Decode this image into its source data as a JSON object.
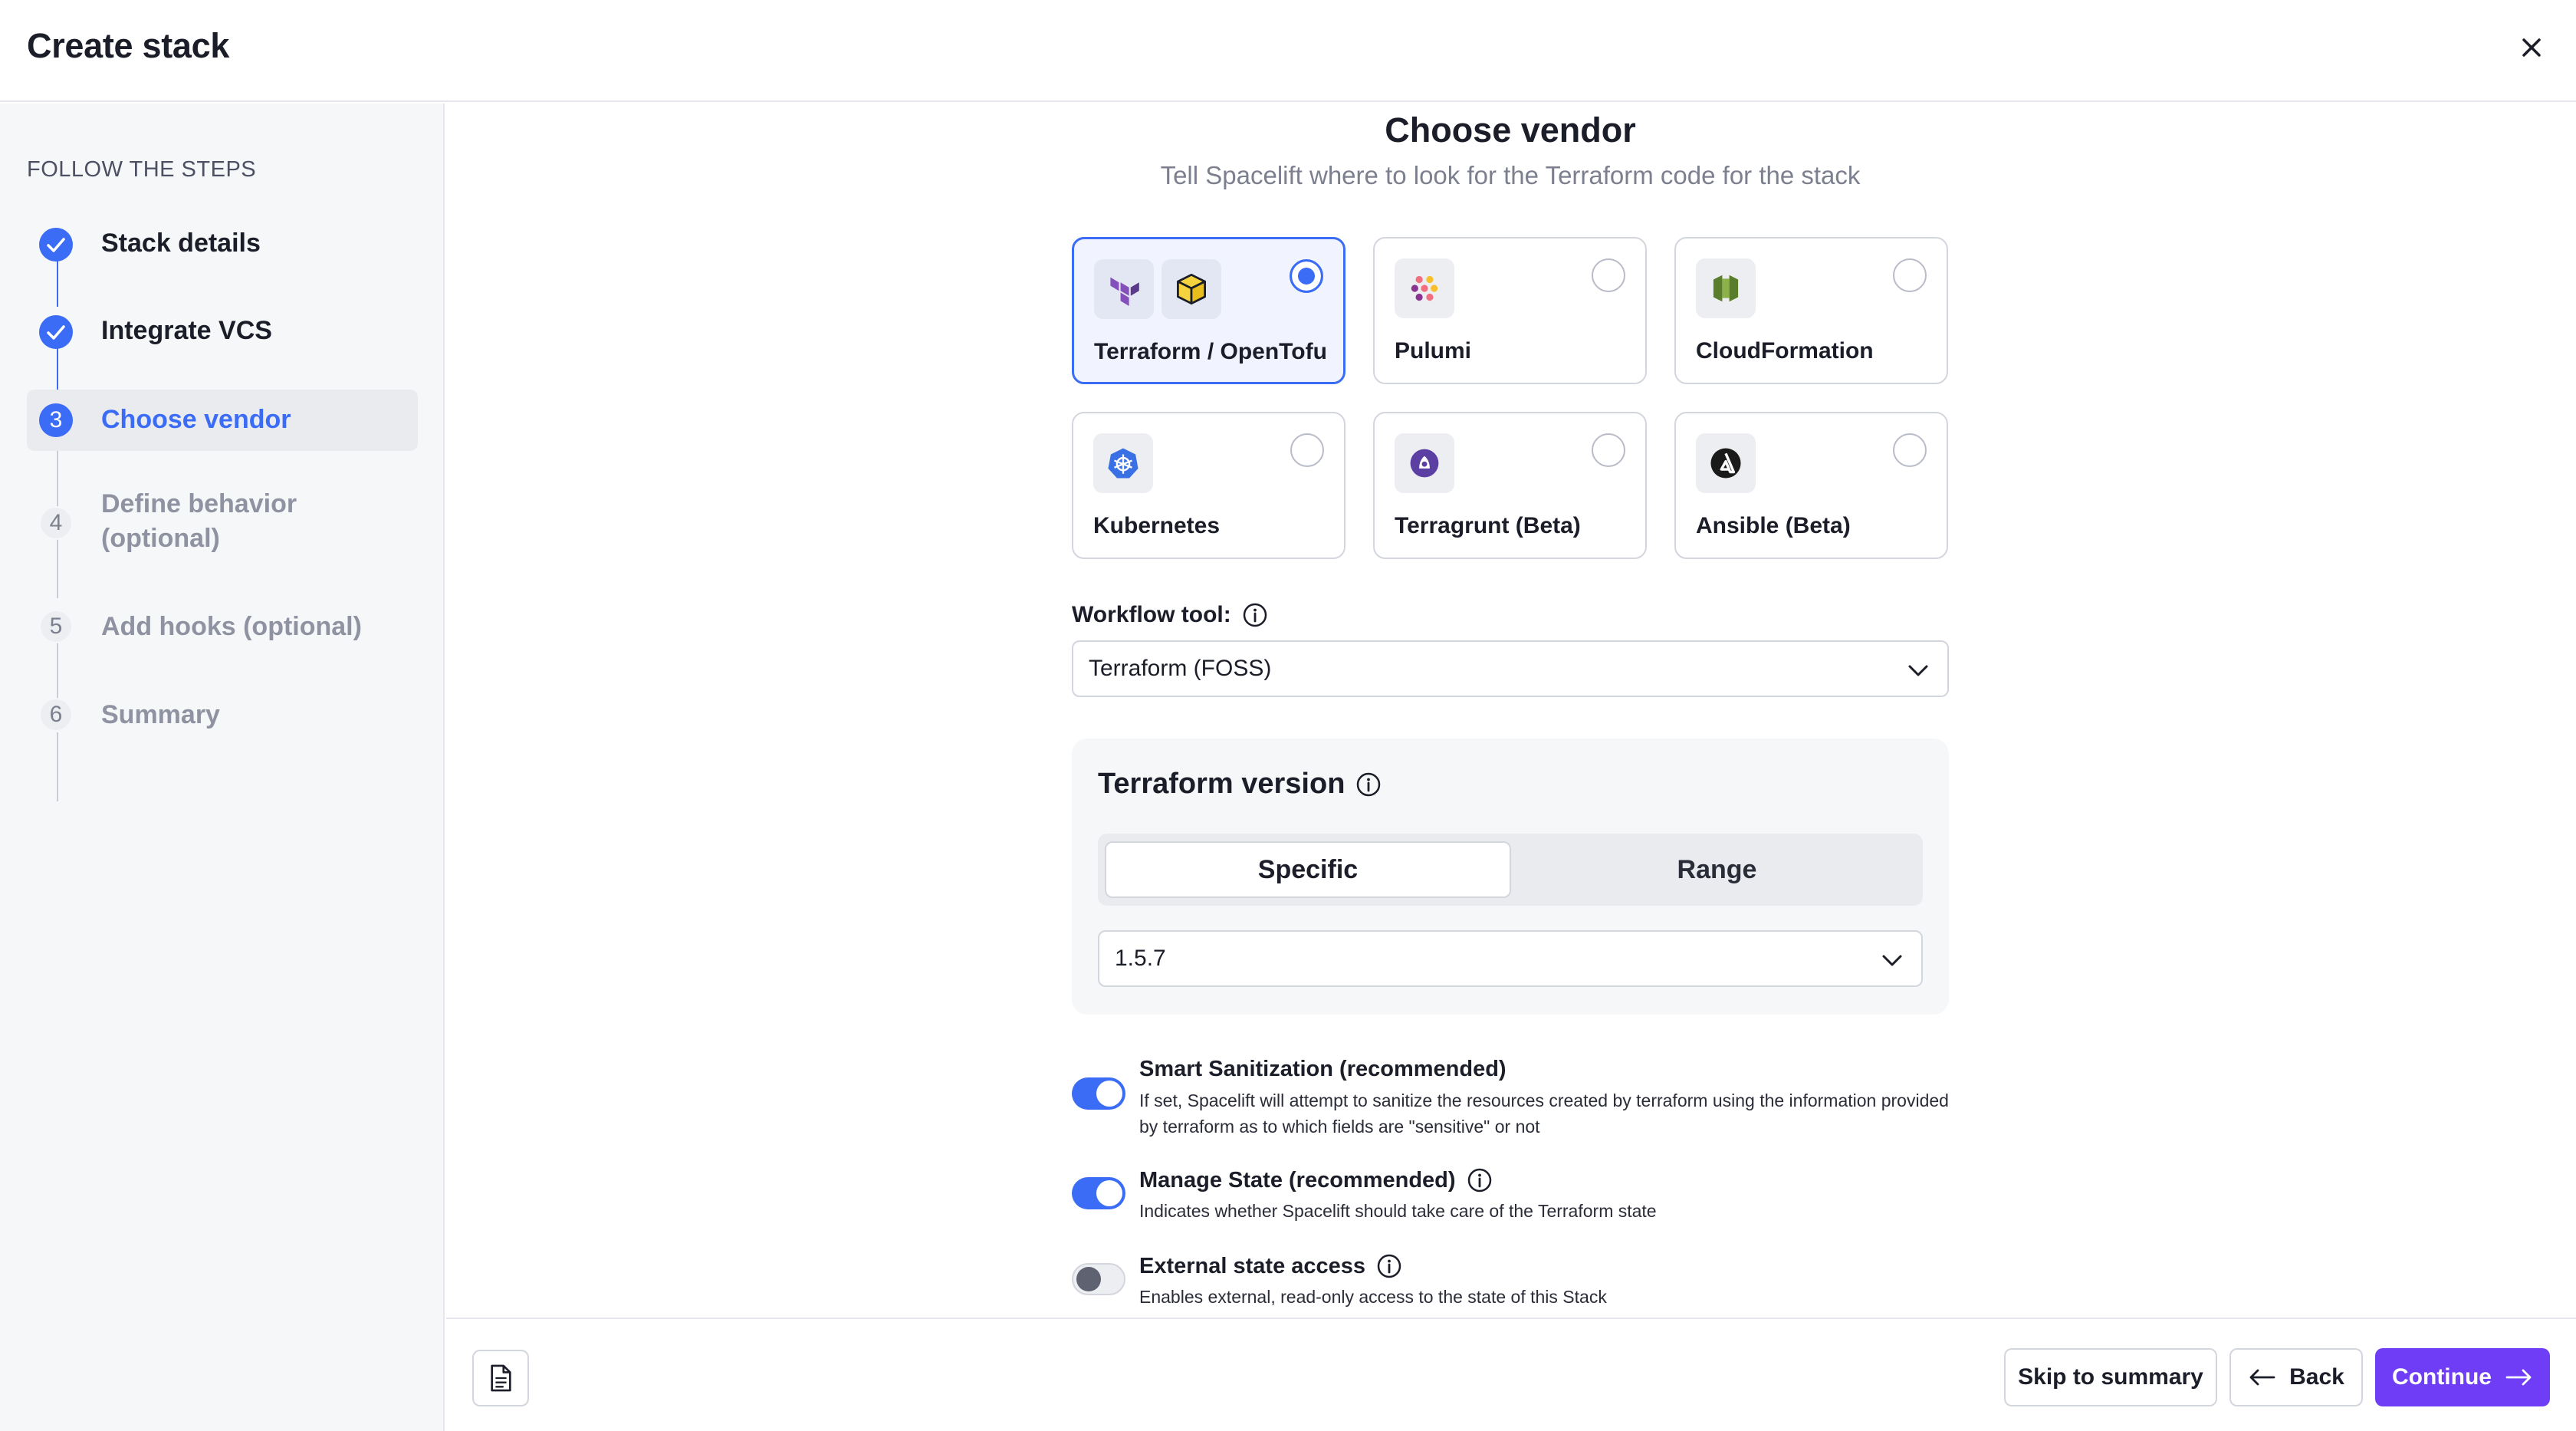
{
  "header": {
    "title": "Create stack"
  },
  "sidebar": {
    "heading": "FOLLOW THE STEPS",
    "steps": [
      {
        "label": "Stack details",
        "state": "done",
        "number": "1"
      },
      {
        "label": "Integrate VCS",
        "state": "done",
        "number": "2"
      },
      {
        "label": "Choose vendor",
        "state": "current",
        "number": "3"
      },
      {
        "label": "Define behavior (optional)",
        "state": "pending",
        "number": "4"
      },
      {
        "label": "Add hooks (optional)",
        "state": "pending",
        "number": "5"
      },
      {
        "label": "Summary",
        "state": "pending",
        "number": "6"
      }
    ]
  },
  "main": {
    "title": "Choose vendor",
    "subtitle": "Tell Spacelift where to look for the Terraform code for the stack",
    "vendors": [
      {
        "name": "Terraform / OpenTofu",
        "selected": true,
        "icons": [
          "terraform-icon",
          "opentofu-icon"
        ]
      },
      {
        "name": "Pulumi",
        "selected": false,
        "icons": [
          "pulumi-icon"
        ]
      },
      {
        "name": "CloudFormation",
        "selected": false,
        "icons": [
          "cloudformation-icon"
        ]
      },
      {
        "name": "Kubernetes",
        "selected": false,
        "icons": [
          "kubernetes-icon"
        ]
      },
      {
        "name": "Terragrunt (Beta)",
        "selected": false,
        "icons": [
          "terragrunt-icon"
        ]
      },
      {
        "name": "Ansible (Beta)",
        "selected": false,
        "icons": [
          "ansible-icon"
        ]
      }
    ],
    "workflow_tool": {
      "label": "Workflow tool:",
      "value": "Terraform (FOSS)"
    },
    "terraform_version": {
      "title": "Terraform version",
      "modes": [
        "Specific",
        "Range"
      ],
      "selected_mode": "Specific",
      "value": "1.5.7"
    },
    "toggles": [
      {
        "title": "Smart Sanitization (recommended)",
        "description": "If set, Spacelift will attempt to sanitize the resources created by terraform using the information provided by terraform as to which fields are \"sensitive\" or not",
        "on": true,
        "info": false
      },
      {
        "title": "Manage State (recommended)",
        "description": "Indicates whether Spacelift should take care of the Terraform state",
        "on": true,
        "info": true
      },
      {
        "title": "External state access",
        "description": "Enables external, read-only access to the state of this Stack",
        "on": false,
        "info": true
      }
    ]
  },
  "footer": {
    "skip_label": "Skip to summary",
    "back_label": "Back",
    "continue_label": "Continue"
  },
  "colors": {
    "accent": "#3b6cf5",
    "primary_button": "#6e3df5"
  }
}
